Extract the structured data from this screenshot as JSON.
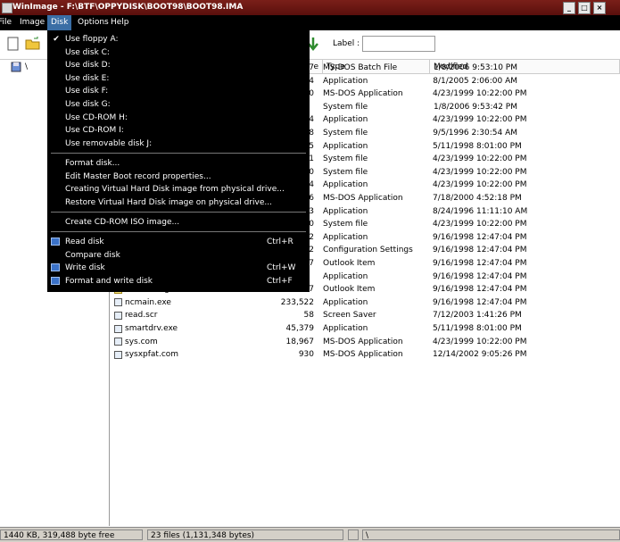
{
  "window": {
    "title": "WinImage - F:\\BTF\\OPPYDISK\\BOOT98\\BOOT98.IMA",
    "minimize": "_",
    "maximize": "□",
    "close": "×"
  },
  "menubar": {
    "items": [
      {
        "label": "File"
      },
      {
        "label": "Image"
      },
      {
        "label": "Disk"
      },
      {
        "label": "Options"
      },
      {
        "label": "Help"
      }
    ]
  },
  "toolbar": {
    "label_text": "Label :",
    "label_value": ""
  },
  "tree": {
    "root": "\\"
  },
  "list": {
    "columns": [
      "e",
      "Type",
      "Modified"
    ],
    "rows": [
      {
        "name": "",
        "size": "7",
        "type": "MS-DOS Batch File",
        "modified": "1/8/2006  9:53:10 PM"
      },
      {
        "name": "",
        "size": "4",
        "type": "Application",
        "modified": "8/1/2005  2:06:00 AM"
      },
      {
        "name": "",
        "size": "0",
        "type": "MS-DOS Application",
        "modified": "4/23/1999  10:22:00 PM"
      },
      {
        "name": "",
        "size": "",
        "type": "System file",
        "modified": "1/8/2006  9:53:42 PM"
      },
      {
        "name": "",
        "size": "4",
        "type": "Application",
        "modified": "4/23/1999  10:22:00 PM"
      },
      {
        "name": "",
        "size": "8",
        "type": "System file",
        "modified": "9/5/1996  2:30:54 AM"
      },
      {
        "name": "",
        "size": "5",
        "type": "Application",
        "modified": "5/11/1998  8:01:00 PM"
      },
      {
        "name": "",
        "size": "1",
        "type": "System file",
        "modified": "4/23/1999  10:22:00 PM"
      },
      {
        "name": "",
        "size": "0",
        "type": "System file",
        "modified": "4/23/1999  10:22:00 PM"
      },
      {
        "name": "",
        "size": "4",
        "type": "Application",
        "modified": "4/23/1999  10:22:00 PM"
      },
      {
        "name": "",
        "size": "6",
        "type": "MS-DOS Application",
        "modified": "7/18/2000  4:52:18 PM"
      },
      {
        "name": "",
        "size": "3",
        "type": "Application",
        "modified": "8/24/1996  11:11:10 AM"
      },
      {
        "name": "",
        "size": "0",
        "type": "System file",
        "modified": "4/23/1999  10:22:00 PM"
      },
      {
        "name": "",
        "size": "2",
        "type": "Application",
        "modified": "9/16/1998  12:47:04 PM"
      },
      {
        "name": "",
        "size": "2",
        "type": "Configuration Settings",
        "modified": "9/16/1998  12:47:04 PM"
      },
      {
        "name": "",
        "size": "7",
        "type": "Outlook Item",
        "modified": "9/16/1998  12:47:04 PM"
      },
      {
        "name": "",
        "size": "",
        "type": "Application",
        "modified": "9/16/1998  12:47:04 PM"
      },
      {
        "name": "ncedit.msg",
        "size": "1,987",
        "type": "Outlook Item",
        "modified": "9/16/1998  12:47:04 PM",
        "icon": "envelope-icon"
      },
      {
        "name": "ncmain.exe",
        "size": "233,522",
        "type": "Application",
        "modified": "9/16/1998  12:47:04 PM",
        "icon": "exe-icon"
      },
      {
        "name": "read.scr",
        "size": "58",
        "type": "Screen Saver",
        "modified": "7/12/2003  1:41:26 PM",
        "icon": "file-icon"
      },
      {
        "name": "smartdrv.exe",
        "size": "45,379",
        "type": "Application",
        "modified": "5/11/1998  8:01:00 PM",
        "icon": "exe-icon"
      },
      {
        "name": "sys.com",
        "size": "18,967",
        "type": "MS-DOS Application",
        "modified": "4/23/1999  10:22:00 PM",
        "icon": "exe-icon"
      },
      {
        "name": "sysxpfat.com",
        "size": "930",
        "type": "MS-DOS Application",
        "modified": "12/14/2002  9:05:26 PM",
        "icon": "exe-icon"
      }
    ]
  },
  "disk_menu": {
    "items": [
      {
        "label": "Use floppy A:",
        "checked": true
      },
      {
        "label": "Use disk C:"
      },
      {
        "label": "Use disk D:"
      },
      {
        "label": "Use disk E:"
      },
      {
        "label": "Use disk F:"
      },
      {
        "label": "Use disk G:"
      },
      {
        "label": "Use CD-ROM H:"
      },
      {
        "label": "Use CD-ROM I:"
      },
      {
        "label": "Use removable disk J:"
      },
      {
        "sep": true
      },
      {
        "label": "Format disk..."
      },
      {
        "label": "Edit Master Boot record properties..."
      },
      {
        "label": "Creating Virtual Hard Disk image from physical drive..."
      },
      {
        "label": "Restore Virtual Hard Disk image on physical drive..."
      },
      {
        "sep": true
      },
      {
        "label": "Create CD-ROM ISO image..."
      },
      {
        "sep": true
      },
      {
        "label": "Read disk",
        "shortcut": "Ctrl+R",
        "icon": "read-disk-icon"
      },
      {
        "label": "Compare disk"
      },
      {
        "label": "Write disk",
        "shortcut": "Ctrl+W",
        "icon": "write-disk-icon"
      },
      {
        "label": "Format and write disk",
        "shortcut": "Ctrl+F",
        "icon": "format-write-icon"
      }
    ]
  },
  "status": {
    "pane1": "1440 KB, 319,488 byte free",
    "pane2": "23 files (1,131,348 bytes)",
    "pane3": "\\"
  }
}
